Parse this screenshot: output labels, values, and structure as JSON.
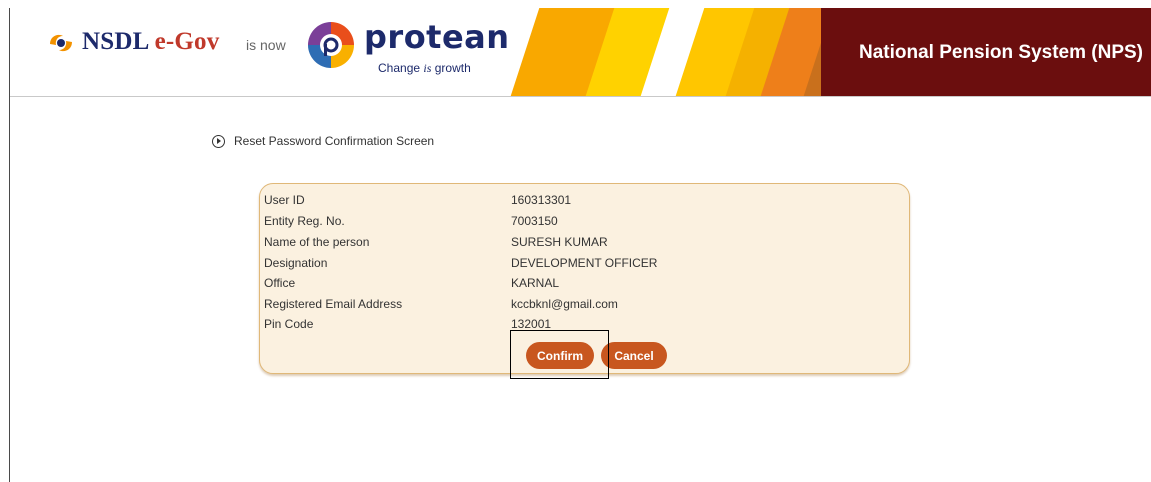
{
  "header": {
    "brand_name_part1": "NSDL ",
    "brand_name_part2": "e-Gov",
    "is_now_text": "is now",
    "protean_name": "protean",
    "tagline_part1": "Change ",
    "tagline_part2": "is",
    "tagline_part3": " growth",
    "system_title": "National Pension System (NPS)",
    "colors": {
      "brand_blue": "#1d2a6b",
      "header_red": "#6b0e0e",
      "stripe_yellow": "#f9c300",
      "stripe_orange": "#f07c00"
    }
  },
  "section": {
    "icon": "circle-arrow-right-icon",
    "title": "Reset Password Confirmation Screen"
  },
  "details": [
    {
      "label": "User ID",
      "value": "160313301"
    },
    {
      "label": "Entity Reg. No.",
      "value": "7003150"
    },
    {
      "label": "Name of the person",
      "value": "SURESH KUMAR"
    },
    {
      "label": "Designation",
      "value": "DEVELOPMENT OFFICER"
    },
    {
      "label": "Office",
      "value": "KARNAL"
    },
    {
      "label": "Registered Email Address",
      "value": "kccbknl@gmail.com"
    },
    {
      "label": "Pin Code",
      "value": "132001"
    }
  ],
  "buttons": {
    "confirm_label": "Confirm",
    "cancel_label": "Cancel",
    "color": "#c8571f"
  }
}
